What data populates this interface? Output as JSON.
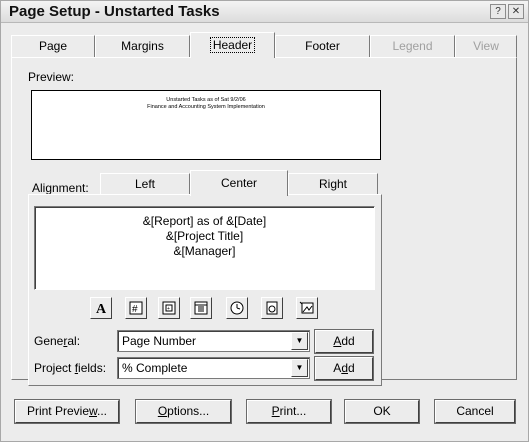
{
  "window": {
    "title": "Page Setup - Unstarted Tasks",
    "help_glyph": "?",
    "close_glyph": "✕"
  },
  "tabs": [
    {
      "label": "Page",
      "state": "normal"
    },
    {
      "label": "Margins",
      "state": "normal"
    },
    {
      "label": "Header",
      "state": "active"
    },
    {
      "label": "Footer",
      "state": "normal"
    },
    {
      "label": "Legend",
      "state": "disabled"
    },
    {
      "label": "View",
      "state": "disabled"
    }
  ],
  "preview": {
    "label": "Preview:",
    "lines": [
      "Unstarted Tasks as of Sat 9/2/06",
      "Finance and Accounting System Implementation"
    ]
  },
  "alignment": {
    "label": "Alignment:",
    "tabs": [
      {
        "label": "Left"
      },
      {
        "label": "Center"
      },
      {
        "label": "Right"
      }
    ],
    "active": "Center",
    "text_lines": [
      "&[Report] as of &[Date]",
      "&[Project Title]",
      "&[Manager]"
    ]
  },
  "toolbar_icons": [
    {
      "name": "format-text-font-icon"
    },
    {
      "name": "insert-page-number-icon"
    },
    {
      "name": "insert-total-page-count-icon"
    },
    {
      "name": "insert-current-date-icon"
    },
    {
      "name": "insert-current-time-icon"
    },
    {
      "name": "insert-file-name-icon"
    },
    {
      "name": "insert-picture-icon"
    }
  ],
  "general": {
    "label_pre": "Gene",
    "label_accel": "r",
    "label_post": "al:",
    "value": "Page Number",
    "add_pre": "",
    "add_accel": "A",
    "add_post": "dd"
  },
  "project_fields": {
    "label_pre": "Project ",
    "label_accel": "f",
    "label_post": "ields:",
    "value": "% Complete",
    "add_pre": "A",
    "add_accel": "d",
    "add_post": "d"
  },
  "buttons": {
    "print_preview": {
      "pre": "Print Previe",
      "accel": "w",
      "post": "..."
    },
    "options": {
      "pre": "",
      "accel": "O",
      "post": "ptions..."
    },
    "print": {
      "pre": "",
      "accel": "P",
      "post": "rint..."
    },
    "ok": "OK",
    "cancel": "Cancel"
  }
}
